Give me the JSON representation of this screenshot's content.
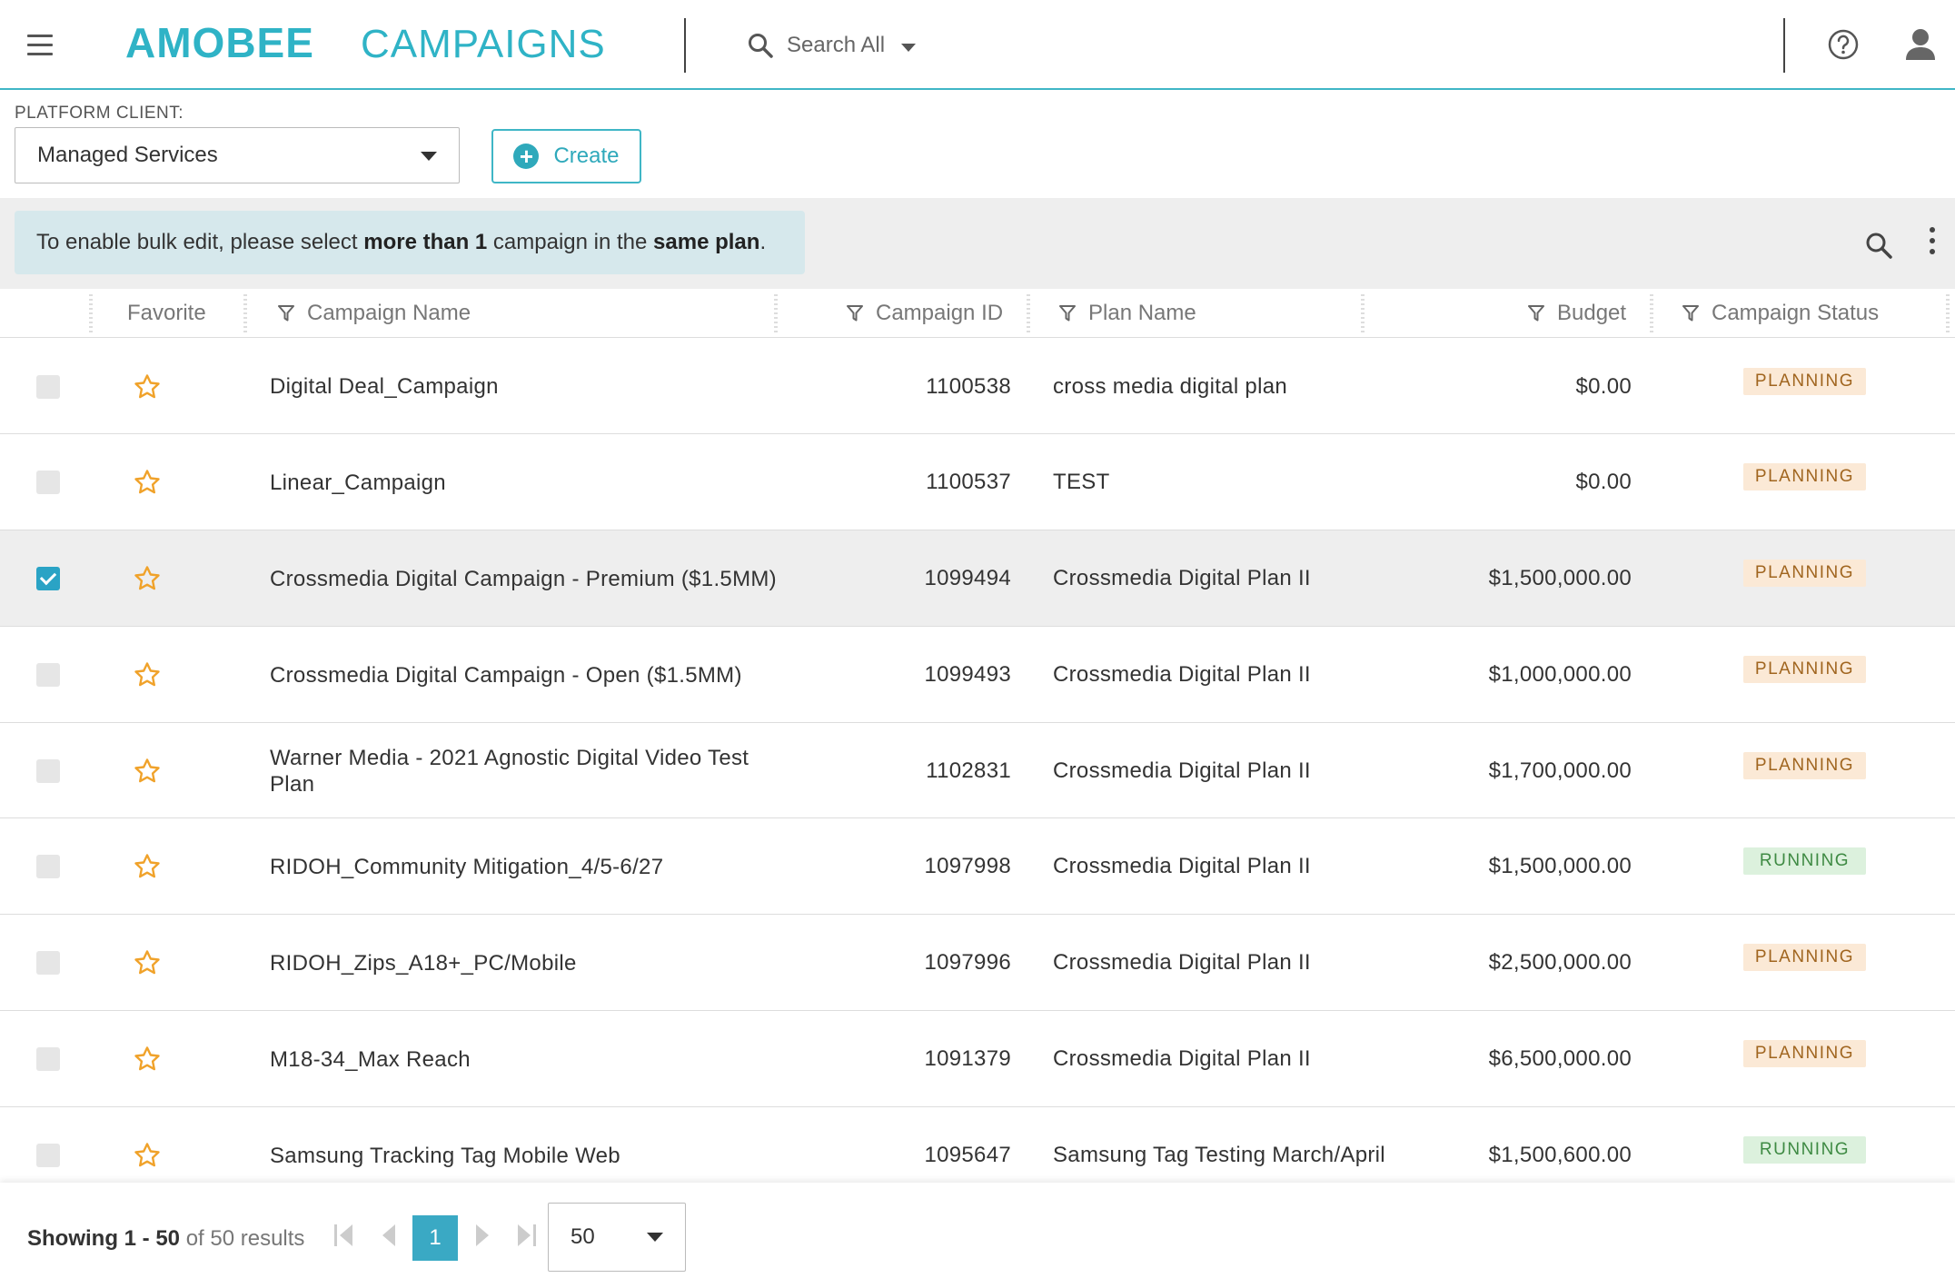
{
  "header": {
    "logo": "AMOBEE",
    "app_name": "CAMPAIGNS",
    "search_label": "Search All"
  },
  "client": {
    "label": "PLATFORM CLIENT:",
    "selected": "Managed Services",
    "create_label": "Create"
  },
  "info": {
    "part1": "To enable bulk edit, please select ",
    "bold1": "more than 1",
    "part2": " campaign in the ",
    "bold2": "same plan",
    "part3": "."
  },
  "columns": {
    "favorite": "Favorite",
    "campaign_name": "Campaign Name",
    "campaign_id": "Campaign ID",
    "plan_name": "Plan Name",
    "budget": "Budget",
    "status": "Campaign Status"
  },
  "rows": [
    {
      "name": "Digital Deal_Campaign",
      "id": "1100538",
      "plan": "cross media digital plan",
      "budget": "$0.00",
      "status": "PLANNING",
      "checked": false
    },
    {
      "name": "Linear_Campaign",
      "id": "1100537",
      "plan": "TEST",
      "budget": "$0.00",
      "status": "PLANNING",
      "checked": false
    },
    {
      "name": "Crossmedia Digital Campaign - Premium ($1.5MM)",
      "id": "1099494",
      "plan": "Crossmedia Digital Plan II",
      "budget": "$1,500,000.00",
      "status": "PLANNING",
      "checked": true
    },
    {
      "name": "Crossmedia Digital Campaign - Open ($1.5MM)",
      "id": "1099493",
      "plan": "Crossmedia Digital Plan II",
      "budget": "$1,000,000.00",
      "status": "PLANNING",
      "checked": false
    },
    {
      "name": "Warner Media - 2021 Agnostic Digital Video Test Plan",
      "id": "1102831",
      "plan": "Crossmedia Digital Plan II",
      "budget": "$1,700,000.00",
      "status": "PLANNING",
      "checked": false
    },
    {
      "name": "RIDOH_Community Mitigation_4/5-6/27",
      "id": "1097998",
      "plan": "Crossmedia Digital Plan II",
      "budget": "$1,500,000.00",
      "status": "RUNNING",
      "checked": false
    },
    {
      "name": "RIDOH_Zips_A18+_PC/Mobile",
      "id": "1097996",
      "plan": "Crossmedia Digital Plan II",
      "budget": "$2,500,000.00",
      "status": "PLANNING",
      "checked": false
    },
    {
      "name": "M18-34_Max Reach",
      "id": "1091379",
      "plan": "Crossmedia Digital Plan II",
      "budget": "$6,500,000.00",
      "status": "PLANNING",
      "checked": false
    },
    {
      "name": "Samsung Tracking Tag Mobile Web",
      "id": "1095647",
      "plan": "Samsung Tag Testing March/April",
      "budget": "$1,500,600.00",
      "status": "RUNNING",
      "checked": false
    }
  ],
  "footer": {
    "showing_bold": "Showing 1 - 50",
    "showing_rest": " of 50 results",
    "current_page": "1",
    "page_size": "50"
  },
  "colors": {
    "accent": "#2fb3c6",
    "planning_bg": "#fbe9d6",
    "running_bg": "#dcf1dd",
    "star": "#f0a22a"
  },
  "icons": [
    "menu-icon",
    "search-icon",
    "chevron-down-icon",
    "help-icon",
    "user-icon",
    "plus-circle-icon",
    "filter-icon",
    "star-icon",
    "kebab-icon",
    "first-page-icon",
    "prev-page-icon",
    "next-page-icon",
    "last-page-icon"
  ]
}
